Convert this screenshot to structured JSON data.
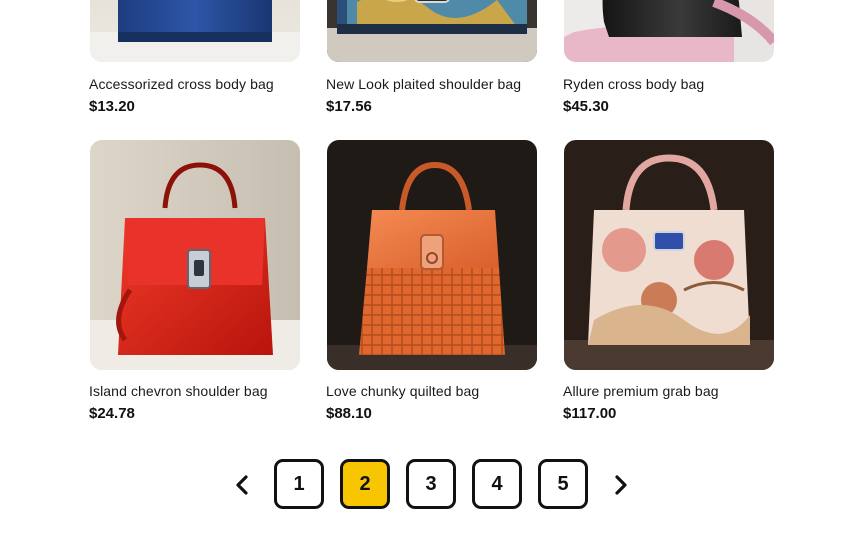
{
  "products": [
    {
      "name": "Accessorized cross body bag",
      "price": "$13.20",
      "image": "blue-leather-bag"
    },
    {
      "name": "New Look plaited shoulder bag",
      "price": "$17.56",
      "image": "floral-print-bag"
    },
    {
      "name": "Ryden cross body bag",
      "price": "$45.30",
      "image": "black-leather-bag"
    },
    {
      "name": "Island chevron shoulder bag",
      "price": "$24.78",
      "image": "red-leather-handbag"
    },
    {
      "name": "Love chunky quilted bag",
      "price": "$88.10",
      "image": "orange-woven-handbag"
    },
    {
      "name": "Allure premium grab bag",
      "price": "$117.00",
      "image": "floral-print-handbag"
    }
  ],
  "pagination": {
    "pages": [
      "1",
      "2",
      "3",
      "4",
      "5"
    ],
    "current_page": "2",
    "prev_icon": "chevron-left-icon",
    "next_icon": "chevron-right-icon",
    "active_color": "#f7c600"
  }
}
